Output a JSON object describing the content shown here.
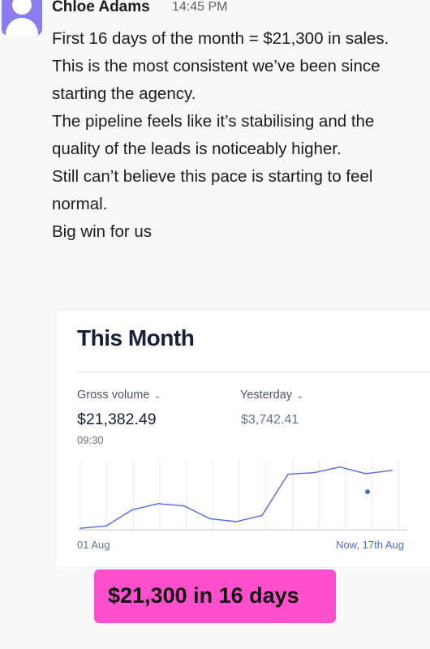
{
  "message": {
    "sender": "Chloe Adams",
    "time": "14:45 PM",
    "lines": [
      "First 16 days of the month = $21,300 in sales.",
      "This is the most consistent we’ve been since starting the agency.",
      "The pipeline feels like it’s stabilising and the quality of the leads is noticeably higher.",
      "Still can’t believe this pace is starting to feel normal.",
      "Big win for us"
    ]
  },
  "card": {
    "title": "This Month",
    "gross_volume_label": "Gross volume",
    "gross_volume_value": "$21,382.49",
    "gross_volume_time": "09:30",
    "yesterday_label": "Yesterday",
    "yesterday_value": "$3,742.41",
    "chevron": "⌄",
    "x_start_label": "01 Aug",
    "x_end_label": "Now, 17th Aug",
    "line_color": "#5469d4"
  },
  "chart_data": {
    "type": "line",
    "x": [
      1,
      2,
      3,
      4,
      5,
      6,
      7,
      8,
      9,
      10,
      11,
      12,
      13
    ],
    "values": [
      0.3,
      0.8,
      4.2,
      5.5,
      5.0,
      2.3,
      1.7,
      3.0,
      11.7,
      12.0,
      13.2,
      11.8,
      12.5
    ],
    "dot_value": 8.0
  },
  "banner": {
    "text": "$21,300 in 16 days",
    "color": "#ff4fcc"
  }
}
